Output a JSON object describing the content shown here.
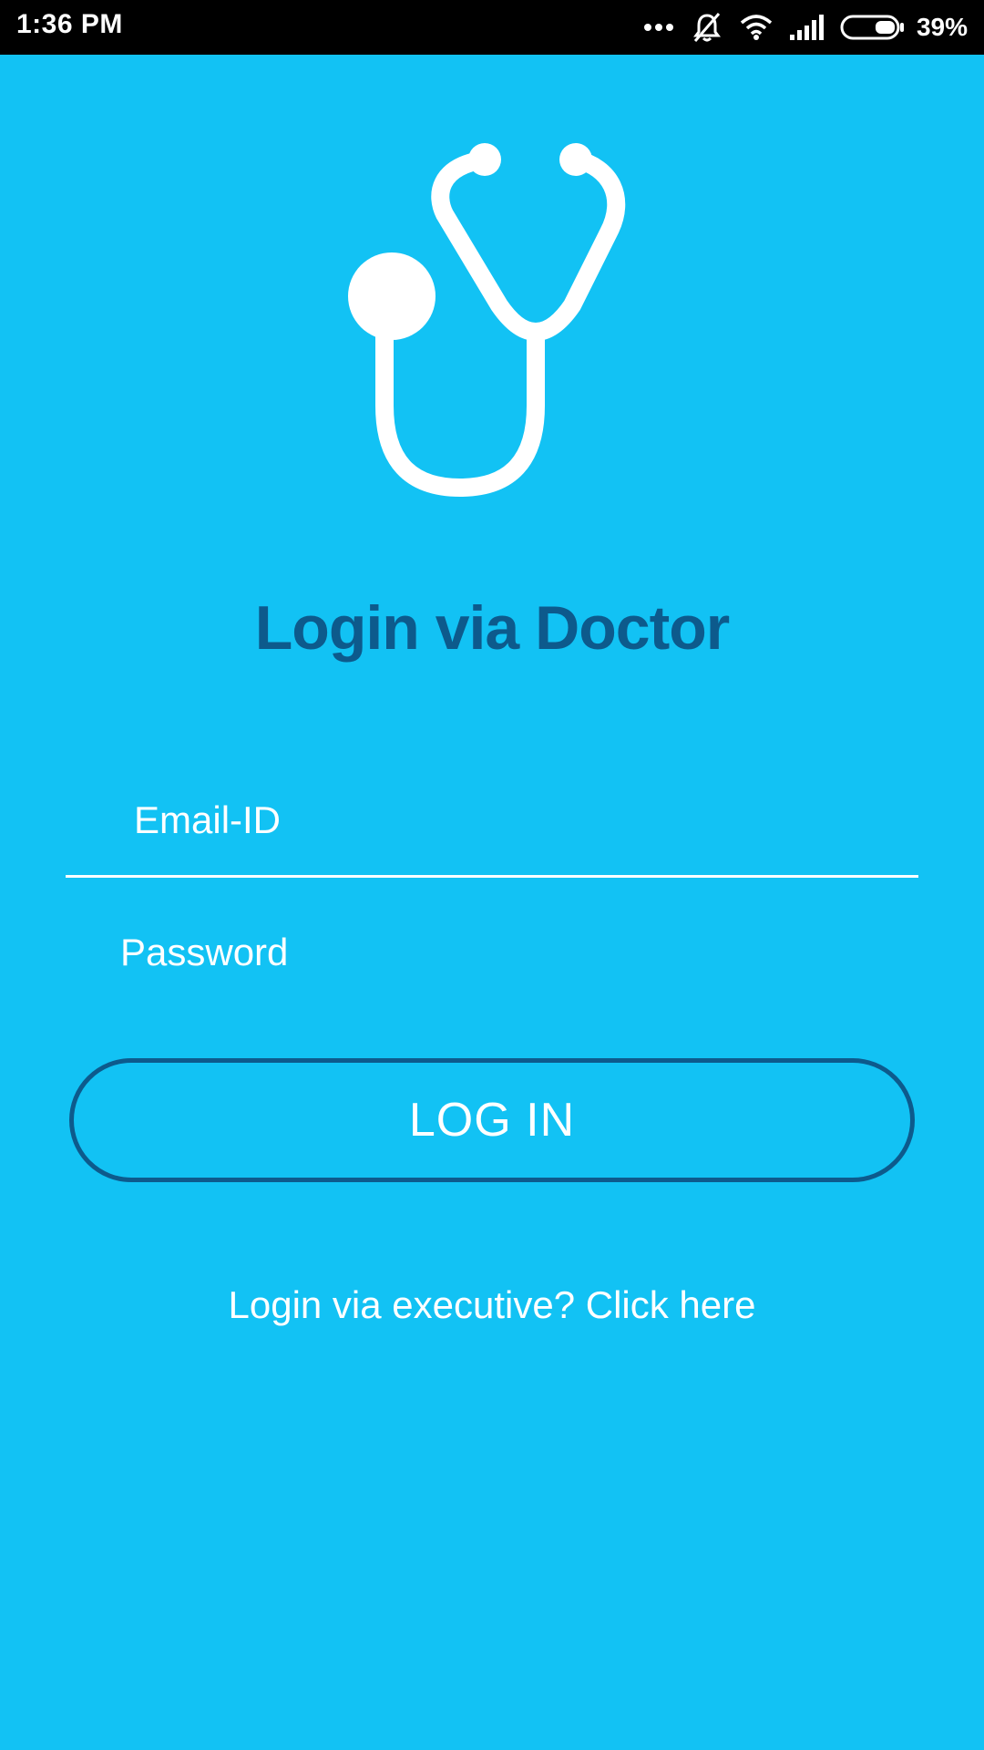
{
  "status_bar": {
    "time": "1:36 PM",
    "battery_percent": "39%",
    "battery_level": 0.39,
    "icons": [
      "more-dots-icon",
      "muted-bell-icon",
      "wifi-icon",
      "signal-icon",
      "battery-icon"
    ]
  },
  "app": {
    "background_color": "#12c2f4",
    "accent_color": "#0d5a8c",
    "logo_icon": "stethoscope-icon",
    "title": "Login via Doctor",
    "email_placeholder": "Email-ID",
    "password_placeholder": "Password",
    "login_button_label": "LOG IN",
    "executive_link_text": "Login via executive? Click here"
  }
}
